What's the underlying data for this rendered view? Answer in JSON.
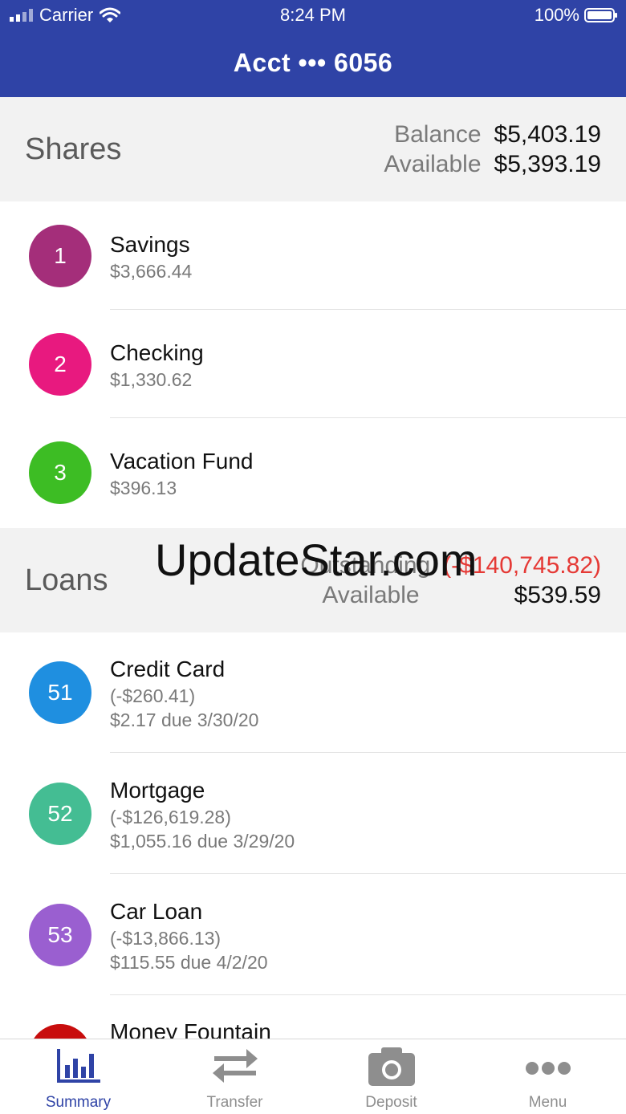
{
  "status_bar": {
    "carrier": "Carrier",
    "time": "8:24 PM",
    "battery": "100%"
  },
  "header": {
    "title": "Acct ••• 6056"
  },
  "shares": {
    "title": "Shares",
    "balance_label": "Balance",
    "balance_value": "$5,403.19",
    "available_label": "Available",
    "available_value": "$5,393.19",
    "items": [
      {
        "number": "1",
        "name": "Savings",
        "amount": "$3,666.44",
        "color": "#a42e7a"
      },
      {
        "number": "2",
        "name": "Checking",
        "amount": "$1,330.62",
        "color": "#e8197f"
      },
      {
        "number": "3",
        "name": "Vacation Fund",
        "amount": "$396.13",
        "color": "#3dbd24"
      }
    ]
  },
  "loans": {
    "title": "Loans",
    "outstanding_label": "Outstanding",
    "outstanding_value": "(-$140,745.82)",
    "available_label": "Available",
    "available_value": "$539.59",
    "items": [
      {
        "number": "51",
        "name": "Credit Card",
        "amount": "(-$260.41)",
        "due": "$2.17 due 3/30/20",
        "color": "#1f8fe0"
      },
      {
        "number": "52",
        "name": "Mortgage",
        "amount": "(-$126,619.28)",
        "due": "$1,055.16 due 3/29/20",
        "color": "#44bd93"
      },
      {
        "number": "53",
        "name": "Car Loan",
        "amount": "(-$13,866.13)",
        "due": "$115.55 due 4/2/20",
        "color": "#9a5fd0"
      },
      {
        "number": "",
        "name": "Money Fountain",
        "color": "#c80d0d"
      }
    ]
  },
  "watermark": "UpdateStar.com",
  "tabs": [
    {
      "label": "Summary",
      "icon": "bar-chart-icon",
      "active": true
    },
    {
      "label": "Transfer",
      "icon": "transfer-arrows-icon",
      "active": false
    },
    {
      "label": "Deposit",
      "icon": "camera-icon",
      "active": false
    },
    {
      "label": "Menu",
      "icon": "more-dots-icon",
      "active": false
    }
  ],
  "colors": {
    "brand": "#2f43a6",
    "negative": "#e53935"
  }
}
